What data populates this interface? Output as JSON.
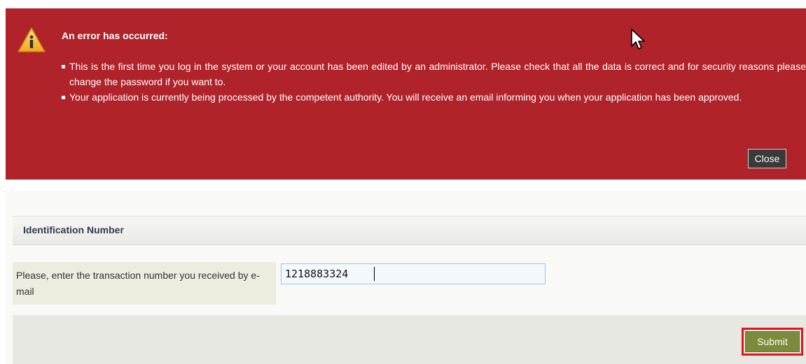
{
  "error": {
    "title": "An error has occurred:",
    "messages": [
      "This is the first time you log in the system or your account has been edited by an administrator. Please check that all the data is correct and for security reasons please change the password if you want to.",
      "Your application is currently being processed by the competent authority. You will receive an email informing you when your application has been approved."
    ],
    "close_label": "Close",
    "background_color": "#b0232b",
    "icon": "warning-icon"
  },
  "form": {
    "section_title": "Identification Number",
    "field_label": "Please, enter the transaction number you received by e-mail",
    "field_value": "1218883324",
    "submit_label": "Submit",
    "submit_color": "#7b8b3a",
    "highlight_color": "#e1141f"
  }
}
